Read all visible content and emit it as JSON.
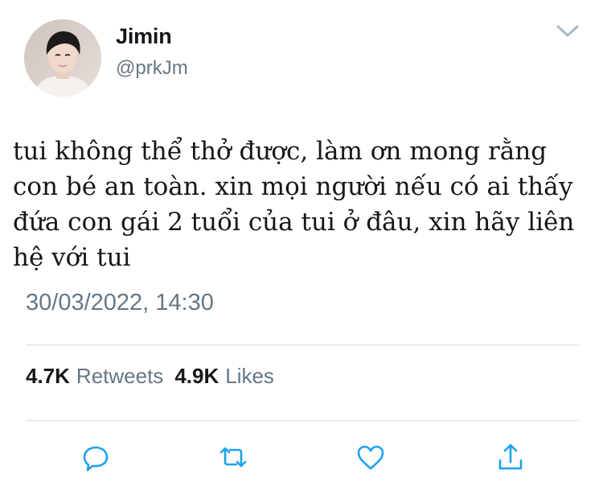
{
  "user": {
    "display_name": "Jimin",
    "handle": "@prkJm"
  },
  "tweet": {
    "text": "tui không thể thở được, làm ơn mong rằng con bé an toàn. xin mọi người nếu có ai thấy đứa con gái 2 tuổi của tui ở đâu, xin hãy liên hệ với tui",
    "timestamp": "30/03/2022, 14:30"
  },
  "stats": {
    "retweets_count": "4.7K",
    "retweets_label": "Retweets",
    "likes_count": "4.9K",
    "likes_label": "Likes"
  },
  "actions": {
    "icons": [
      "reply-icon",
      "retweet-icon",
      "like-icon",
      "share-icon"
    ]
  },
  "colors": {
    "text_primary": "#14171a",
    "text_secondary": "#657786",
    "icon_blue": "#1da1f2",
    "divider": "#d7dce0"
  }
}
